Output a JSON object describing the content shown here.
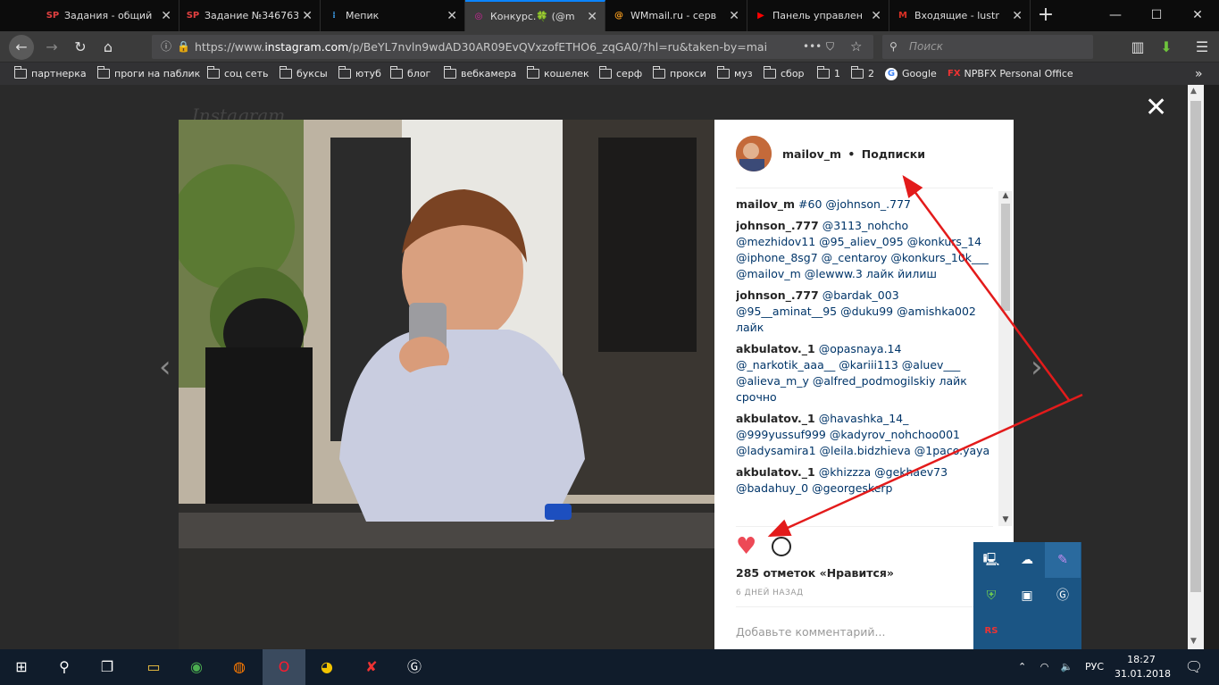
{
  "tabs": [
    {
      "favicon": "SP",
      "favcolor": "#e04040",
      "title": "Задания - общий"
    },
    {
      "favicon": "SP",
      "favcolor": "#e04040",
      "title": "Задание №346763"
    },
    {
      "favicon": "⁞",
      "favcolor": "#3b9be6",
      "title": "Мепик"
    },
    {
      "favicon": "◎",
      "favcolor": "#d6249f",
      "title": "Конкурс.🍀 (@m"
    },
    {
      "favicon": "@",
      "favcolor": "#f29a1d",
      "title": "WMmail.ru - серв"
    },
    {
      "favicon": "▶",
      "favcolor": "#ff0000",
      "title": "Панель управлен"
    },
    {
      "favicon": "M",
      "favcolor": "#d93025",
      "title": "Входящие - lustr"
    }
  ],
  "nav": {
    "url_prefix": "https://www.",
    "url_host": "instagram.com",
    "url_rest": "/p/BeYL7nvln9wdAD30AR09EvQVxzofETHO6_zqGA0/?hl=ru&taken-by=mai",
    "search_placeholder": "Поиск",
    "more_icon": "•••"
  },
  "bookmarks": [
    "партнерка",
    "проги на паблик",
    "соц сеть",
    "буксы",
    "ютуб",
    "блог",
    "вебкамера",
    "кошелек",
    "серф",
    "прокси",
    "муз",
    "сбор",
    "1",
    "2",
    "Google",
    "NPBFX Personal Office"
  ],
  "page": {
    "bg_logo": "Instagram",
    "close": "✕",
    "prev": "‹",
    "next": "›"
  },
  "post": {
    "username": "mailov_m",
    "separator": "•",
    "follow": "Подписки",
    "comments": [
      {
        "user": "mailov_m",
        "text": "#60 @johnson_.777"
      },
      {
        "user": "johnson_.777",
        "text": "@3113_nohcho @mezhidov11 @95_aliev_095 @konkurs_14 @iphone_8sg7 @_centaroy @konkurs_10k___ @mailov_m @lewww.3 лайк йилиш"
      },
      {
        "user": "johnson_.777",
        "text": "@bardak_003 @95__aminat__95 @duku99 @amishka002 лайк"
      },
      {
        "user": "akbulatov._1",
        "text": "@opasnaya.14 @_narkotik_aaa__ @kariii113 @aluev___ @alieva_m_y @alfred_podmogilskiy лайк срочно"
      },
      {
        "user": "akbulatov._1",
        "text": "@havashka_14_ @999yussuf999 @kadyrov_nohchoo001 @ladysamira1 @leila.bidzhieva @1paco.yaya"
      },
      {
        "user": "akbulatov._1",
        "text": "@khizzza @gekhaev73 @badahuy_0 @georgeskerp"
      }
    ],
    "likes": "285 отметок «Нравится»",
    "ago": "6 ДНЕЙ НАЗАД",
    "add_comment": "Добавьте комментарий..."
  },
  "taskbar": {
    "lang": "РУС",
    "time": "18:27",
    "date": "31.01.2018"
  }
}
